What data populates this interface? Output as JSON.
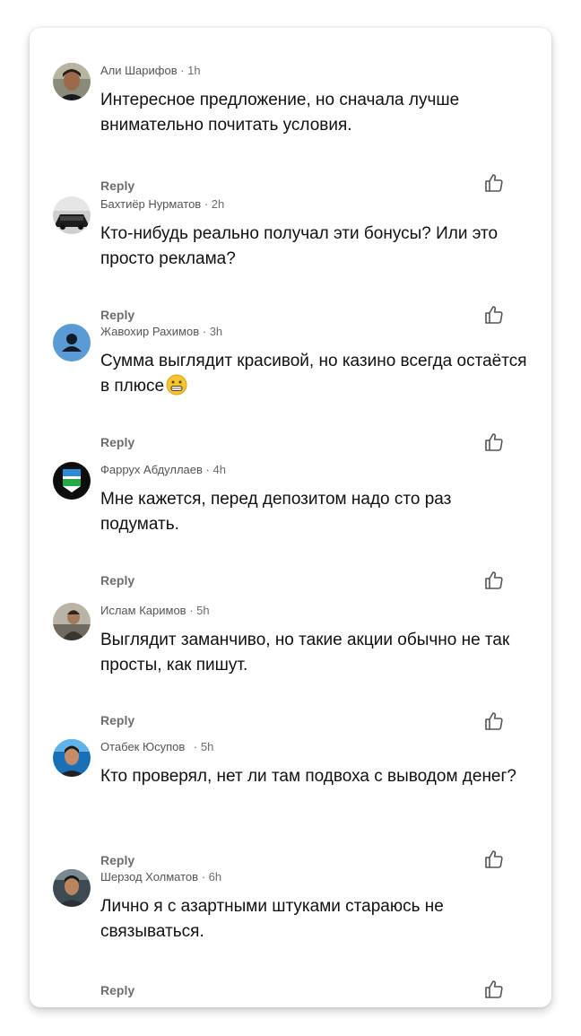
{
  "comments": [
    {
      "author": "Али Шарифов",
      "time": "· 1h",
      "text": "Интересное предложение, но сначала лучше внимательно почитать условия.",
      "reply": "Reply"
    },
    {
      "author": "Бахтиёр Нурматов",
      "time": "· 2h",
      "text": "Кто-нибудь реально получал эти бонусы? Или это просто реклама?",
      "reply": "Reply"
    },
    {
      "author": "Жавохир Рахимов",
      "time": "· 3h",
      "text": "Сумма выглядит красивой, но казино всегда остаётся в плюсе",
      "reply": "Reply"
    },
    {
      "author": "Фаррух Абдуллаев",
      "time": "· 4h",
      "text": "Мне кажется, перед депозитом надо сто раз подумать.",
      "reply": "Reply"
    },
    {
      "author": "Ислам Каримов",
      "time": "· 5h",
      "text": "Выглядит заманчиво, но такие акции обычно не так просты, как пишут.",
      "reply": "Reply"
    },
    {
      "author": "Отабек Юсупов",
      "time": "· 5h",
      "text": "Кто проверял, нет ли там подвоха с выводом денег?",
      "reply": "Reply"
    },
    {
      "author": "Шерзод Холматов",
      "time": "· 6h",
      "text": "Лично я с азартными штуками стараюсь не связываться.",
      "reply": "Reply"
    }
  ],
  "colors": {
    "text": "#111111",
    "meta": "#6b6b6b",
    "reply": "#6e6e6e",
    "default_avatar_bg": "#5b9bd5"
  }
}
